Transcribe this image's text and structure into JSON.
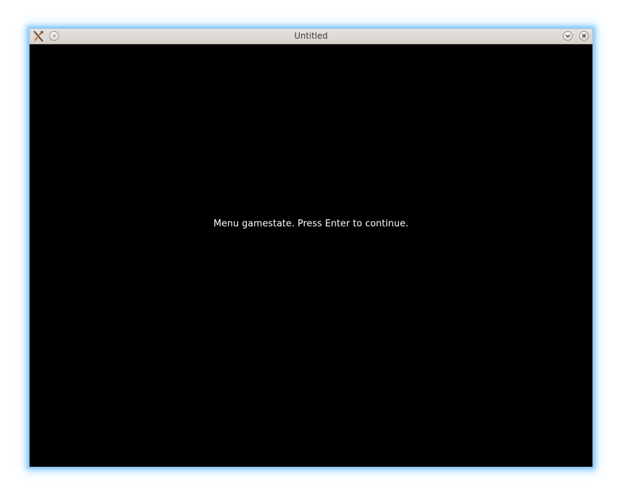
{
  "window": {
    "title": "Untitled",
    "message": "Menu gamestate. Press Enter to continue."
  },
  "icons": {
    "app": "tools-icon",
    "menu": "window-menu-icon",
    "shade": "chevron-down-icon",
    "close": "close-icon"
  },
  "colors": {
    "background": "#000000",
    "text": "#ffffff",
    "titlebar": "#dcd8d4",
    "glow": "#6ebefa"
  }
}
